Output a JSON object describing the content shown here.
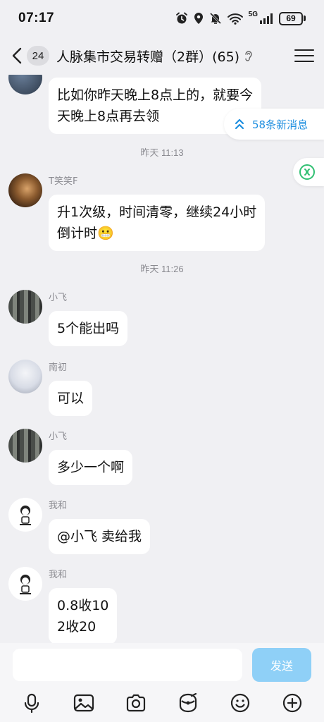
{
  "status_bar": {
    "time": "07:17",
    "network": "5G",
    "battery": "69"
  },
  "header": {
    "unread_count": "24",
    "title": "人脉集市交易转赠（2群）(65)"
  },
  "floating": {
    "new_messages": "58条新消息"
  },
  "messages": [
    {
      "type": "partial",
      "text": "比如你昨天晚上8点上的，就要今\n天晚上8点再去领"
    },
    {
      "type": "time",
      "text": "昨天 11:13"
    },
    {
      "type": "msg",
      "sender": "T笑笑F",
      "text": "升1次级，时间清零，继续24小时\n倒计时😬"
    },
    {
      "type": "time",
      "text": "昨天 11:26"
    },
    {
      "type": "msg",
      "sender": "小飞",
      "text": "5个能出吗"
    },
    {
      "type": "msg",
      "sender": "南初",
      "text": "可以"
    },
    {
      "type": "msg",
      "sender": "小飞",
      "text": "多少一个啊"
    },
    {
      "type": "msg",
      "sender": "我和",
      "text": "@小飞 卖给我"
    },
    {
      "type": "msg",
      "sender": "我和",
      "text": "0.8收10\n2收20"
    }
  ],
  "input": {
    "placeholder": "",
    "value": "",
    "send_label": "发送"
  },
  "toolbar": [
    "microphone-icon",
    "image-icon",
    "camera-icon",
    "red-packet-icon",
    "emoji-icon",
    "plus-icon"
  ],
  "colors": {
    "background": "#f0f0f3",
    "bubble": "#ffffff",
    "accent": "#1f8fe0",
    "send_button": "#8fd0f7"
  }
}
